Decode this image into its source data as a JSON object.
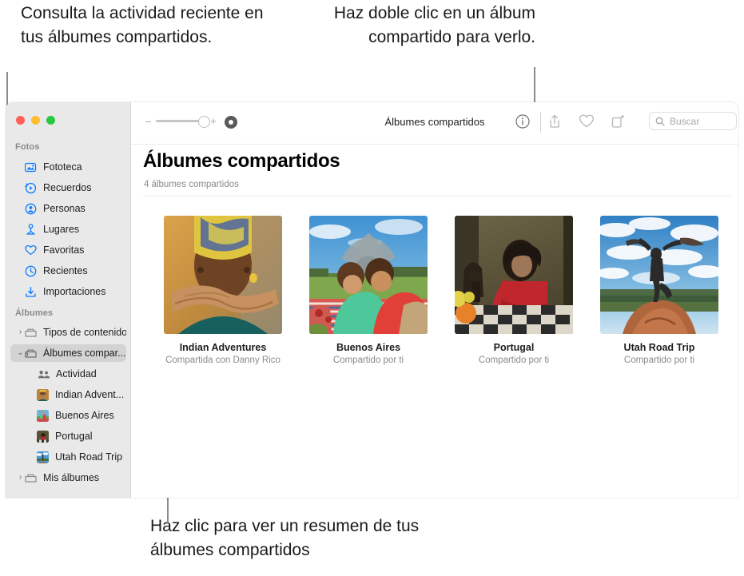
{
  "callouts": {
    "top_left": "Consulta la actividad reciente en tus álbumes compartidos.",
    "top_right": "Haz doble clic en un álbum compartido para verlo.",
    "bottom": "Haz clic para ver un resumen de tus álbumes compartidos"
  },
  "window": {
    "traffic_lights": [
      "close-button",
      "minimize-button",
      "maximize-button"
    ]
  },
  "sidebar": {
    "sections": [
      {
        "title": "Fotos",
        "items": [
          {
            "label": "Fototeca",
            "icon": "photo-library-icon"
          },
          {
            "label": "Recuerdos",
            "icon": "memories-icon"
          },
          {
            "label": "Personas",
            "icon": "people-icon"
          },
          {
            "label": "Lugares",
            "icon": "places-pin-icon"
          },
          {
            "label": "Favoritas",
            "icon": "heart-icon"
          },
          {
            "label": "Recientes",
            "icon": "clock-icon"
          },
          {
            "label": "Importaciones",
            "icon": "import-icon"
          }
        ]
      },
      {
        "title": "Álbumes",
        "items": [
          {
            "label": "Tipos de contenido",
            "icon": "folder-icon",
            "disclosure": "›"
          },
          {
            "label": "Álbumes compar...",
            "icon": "shared-folder-icon",
            "disclosure": "⌄",
            "selected": true
          },
          {
            "label": "Actividad",
            "icon": "activity-people-icon",
            "indent": true
          },
          {
            "label": "Indian Advent...",
            "icon": "album-thumb-indian",
            "indent": true
          },
          {
            "label": "Buenos Aires",
            "icon": "album-thumb-buenos",
            "indent": true
          },
          {
            "label": "Portugal",
            "icon": "album-thumb-portugal",
            "indent": true
          },
          {
            "label": "Utah Road Trip",
            "icon": "album-thumb-utah",
            "indent": true
          },
          {
            "label": "Mis álbumes",
            "icon": "folder-icon",
            "disclosure": "›"
          }
        ]
      }
    ]
  },
  "toolbar": {
    "zoom_minus": "–",
    "zoom_plus": "+",
    "title": "Álbumes compartidos",
    "info_icon": "info-circle-icon",
    "share_icon": "share-icon",
    "favorite_icon": "heart-icon",
    "rotate_icon": "rotate-icon",
    "search_icon": "search-icon",
    "search_placeholder": "Buscar",
    "search_value": ""
  },
  "main": {
    "title": "Álbumes compartidos",
    "subtitle": "4 álbumes compartidos",
    "albums": [
      {
        "name": "Indian Adventures",
        "shared": "Compartida con Danny Rico"
      },
      {
        "name": "Buenos Aires",
        "shared": "Compartido por ti"
      },
      {
        "name": "Portugal",
        "shared": "Compartido por ti"
      },
      {
        "name": "Utah Road Trip",
        "shared": "Compartido por ti"
      }
    ]
  },
  "colors": {
    "accent": "#0a7cff",
    "sidebar_bg": "#e9e9e9",
    "selected_bg": "#d3d3d3",
    "muted_text": "#8a8a8e",
    "lead_line": "#8b8b8b"
  }
}
